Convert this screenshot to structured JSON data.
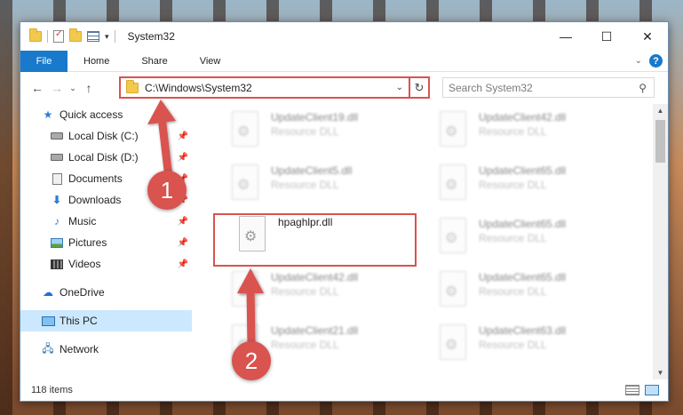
{
  "window": {
    "title": "System32",
    "controls": {
      "minimize": "—",
      "maximize": "☐",
      "close": "✕"
    }
  },
  "ribbon": {
    "tabs": [
      "File",
      "Home",
      "Share",
      "View"
    ]
  },
  "navigation": {
    "address": "C:\\Windows\\System32",
    "search_placeholder": "Search System32"
  },
  "sidebar": {
    "items": [
      {
        "label": "Quick access",
        "icon": "star-icon",
        "pinned": false
      },
      {
        "label": "Local Disk (C:)",
        "icon": "drive-icon",
        "pinned": true
      },
      {
        "label": "Local Disk (D:)",
        "icon": "drive-icon",
        "pinned": true
      },
      {
        "label": "Documents",
        "icon": "documents-icon",
        "pinned": true
      },
      {
        "label": "Downloads",
        "icon": "downloads-icon",
        "pinned": true
      },
      {
        "label": "Music",
        "icon": "music-icon",
        "pinned": true
      },
      {
        "label": "Pictures",
        "icon": "pictures-icon",
        "pinned": true
      },
      {
        "label": "Videos",
        "icon": "videos-icon",
        "pinned": true
      },
      {
        "label": "OneDrive",
        "icon": "onedrive-icon",
        "pinned": false
      },
      {
        "label": "This PC",
        "icon": "this-pc-icon",
        "pinned": false,
        "selected": true
      },
      {
        "label": "Network",
        "icon": "network-icon",
        "pinned": false
      }
    ]
  },
  "files": [
    {
      "name": "UpdateClient19.dll",
      "type": "Resource DLL"
    },
    {
      "name": "UpdateClient42.dll",
      "type": "Resource DLL"
    },
    {
      "name": "UpdateClient5.dll",
      "type": "Resource DLL"
    },
    {
      "name": "UpdateClient65.dll",
      "type": "Resource DLL"
    },
    {
      "name": "hpaghlpr.dll",
      "type": ""
    },
    {
      "name": "UpdateClient65.dll",
      "type": "Resource DLL"
    },
    {
      "name": "UpdateClient42.dll",
      "type": "Resource DLL"
    },
    {
      "name": "UpdateClient65.dll",
      "type": "Resource DLL"
    },
    {
      "name": "UpdateClient21.dll",
      "type": "Resource DLL"
    },
    {
      "name": "UpdateClient63.dll",
      "type": "Resource DLL"
    }
  ],
  "status": {
    "item_count": "118 items"
  },
  "annotations": {
    "step1": "1",
    "step2": "2",
    "color": "#d9534f"
  }
}
